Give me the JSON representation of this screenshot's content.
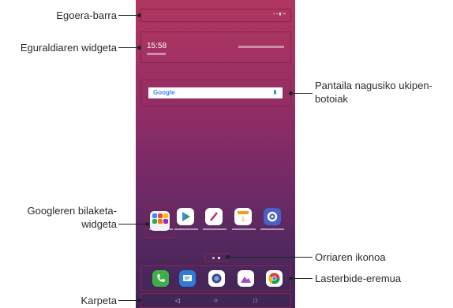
{
  "labels": {
    "status_bar": "Egoera-barra",
    "weather_widget": "Eguraldiaren widgeta",
    "search_widget_l1": "Pantaila nagusiko ukipen-",
    "search_widget_l2": "botoiak",
    "google_search_l1": "Googleren bilaketa-",
    "google_search_l2": "widgeta",
    "page_icon": "Orriaren ikonoa",
    "shortcut_area": "Lasterbide-eremua",
    "folder": "Karpeta"
  },
  "phone": {
    "clock": "15:58",
    "search_logo": "Google",
    "nav": {
      "back": "◁",
      "home": "○",
      "recent": "□"
    }
  },
  "colors": {
    "highlight": "#8a2150",
    "wallpaper_top": "#b0375f",
    "wallpaper_bottom": "#3e2556"
  }
}
